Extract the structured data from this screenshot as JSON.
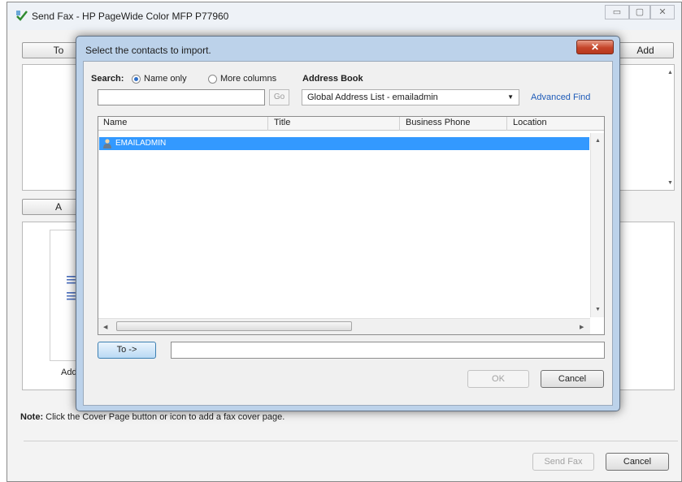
{
  "main_window": {
    "title": "Send Fax - HP PageWide Color MFP P77960",
    "controls": {
      "minimize": "▭",
      "maximize": "▢",
      "close": "✕"
    },
    "to_button": "To",
    "add_button": "Add",
    "cover_button": "A",
    "add_caption": "Add",
    "note_label": "Note:",
    "note_text": "Click the Cover Page button or icon to add a fax cover page.",
    "send_fax_button": "Send Fax",
    "cancel_button": "Cancel"
  },
  "dialog": {
    "title": "Select the contacts to import.",
    "close": "✕",
    "search_label": "Search:",
    "radio_name_only": "Name only",
    "radio_more_columns": "More columns",
    "search_value": "",
    "go_button": "Go",
    "address_book_label": "Address Book",
    "address_book_value": "Global Address List - emailadmin",
    "advanced_find": "Advanced Find",
    "columns": [
      "Name",
      "Title",
      "Business Phone",
      "Location"
    ],
    "contacts": [
      {
        "name": "EMAILADMIN",
        "selected": true
      }
    ],
    "to_button": "To ->",
    "to_value": "",
    "ok_button": "OK",
    "cancel_button": "Cancel"
  },
  "colors": {
    "selection": "#3399ff",
    "link": "#1e5bb8",
    "close_red": "#c5452a",
    "dialog_frame": "#bcd2ea"
  }
}
